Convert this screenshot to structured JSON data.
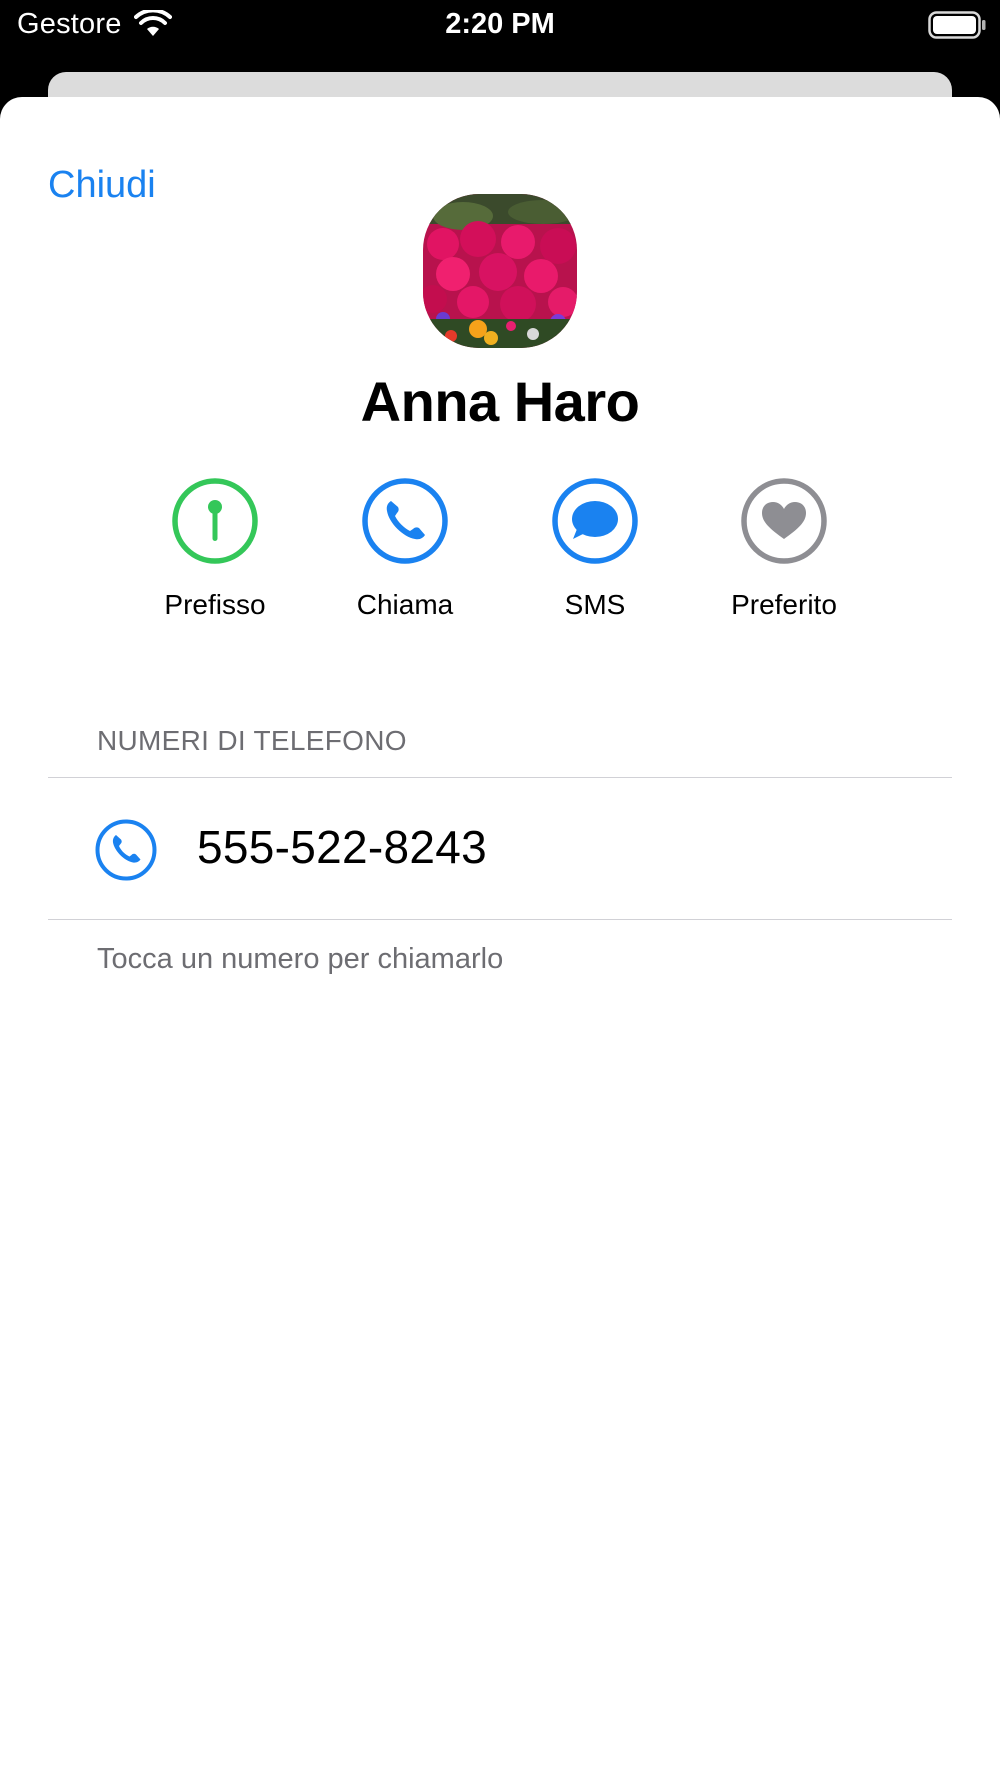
{
  "status_bar": {
    "carrier": "Gestore",
    "time": "2:20 PM"
  },
  "header": {
    "close_label": "Chiudi"
  },
  "contact": {
    "name": "Anna Haro",
    "avatar": "flower-photo"
  },
  "actions": [
    {
      "label": "Prefisso",
      "icon": "pin-icon",
      "color": "#34c759"
    },
    {
      "label": "Chiama",
      "icon": "phone-icon",
      "color": "#1a82f0"
    },
    {
      "label": "SMS",
      "icon": "message-icon",
      "color": "#1a82f0"
    },
    {
      "label": "Preferito",
      "icon": "heart-icon",
      "color": "#8e8e93"
    }
  ],
  "phone_section": {
    "header": "NUMERI DI TELEFONO",
    "numbers": [
      {
        "value": "555-522-8243",
        "icon": "phone-icon"
      }
    ],
    "footer": "Tocca un numero per chiamarlo"
  },
  "colors": {
    "accent": "#1a82f0",
    "green": "#34c759",
    "gray": "#8e8e93"
  }
}
